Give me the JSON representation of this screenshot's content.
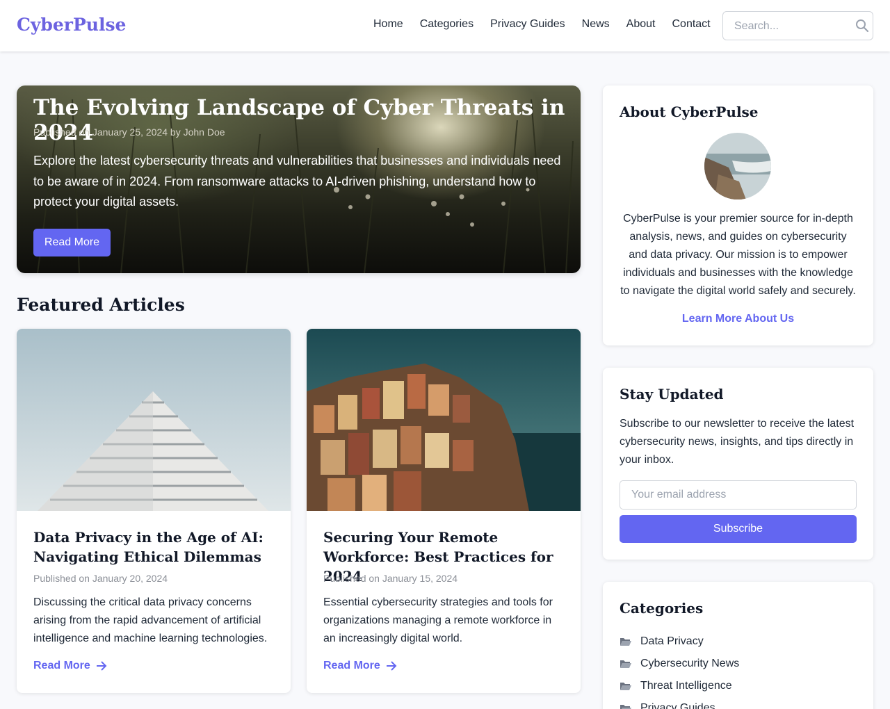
{
  "brand": {
    "name": "CyberPulse",
    "accent": "#6366f1"
  },
  "nav": {
    "items": [
      "Home",
      "Categories",
      "Privacy Guides",
      "News",
      "About",
      "Contact"
    ]
  },
  "search": {
    "placeholder": "Search...",
    "icon": "search-icon"
  },
  "hero": {
    "title": "The Evolving Landscape of Cyber Threats in 2024",
    "meta": "Published on January 25, 2024 by John Doe",
    "description": "Explore the latest cybersecurity threats and vulnerabilities that businesses and individuals need to be aware of in 2024. From ransomware attacks to AI-driven phishing, understand how to protect your digital assets.",
    "button": "Read More"
  },
  "featured": {
    "heading": "Featured Articles",
    "articles": [
      {
        "title": "Data Privacy in the Age of AI: Navigating Ethical Dilemmas",
        "meta": "Published on January 20, 2024",
        "description": "Discussing the critical data privacy concerns arising from the rapid advancement of artificial intelligence and machine learning technologies.",
        "link": "Read More"
      },
      {
        "title": "Securing Your Remote Workforce: Best Practices for 2024",
        "meta": "Published on January 15, 2024",
        "description": "Essential cybersecurity strategies and tools for organizations managing a remote workforce in an increasingly digital world.",
        "link": "Read More"
      }
    ]
  },
  "sidebar": {
    "about": {
      "title": "About CyberPulse",
      "text": "CyberPulse is your premier source for in-depth analysis, news, and guides on cybersecurity and data privacy. Our mission is to empower individuals and businesses with the knowledge to navigate the digital world safely and securely.",
      "link": "Learn More About Us"
    },
    "newsletter": {
      "title": "Stay Updated",
      "text": "Subscribe to our newsletter to receive the latest cybersecurity news, insights, and tips directly in your inbox.",
      "placeholder": "Your email address",
      "button": "Subscribe"
    },
    "categories": {
      "title": "Categories",
      "items": [
        "Data Privacy",
        "Cybersecurity News",
        "Threat Intelligence",
        "Privacy Guides"
      ]
    }
  }
}
